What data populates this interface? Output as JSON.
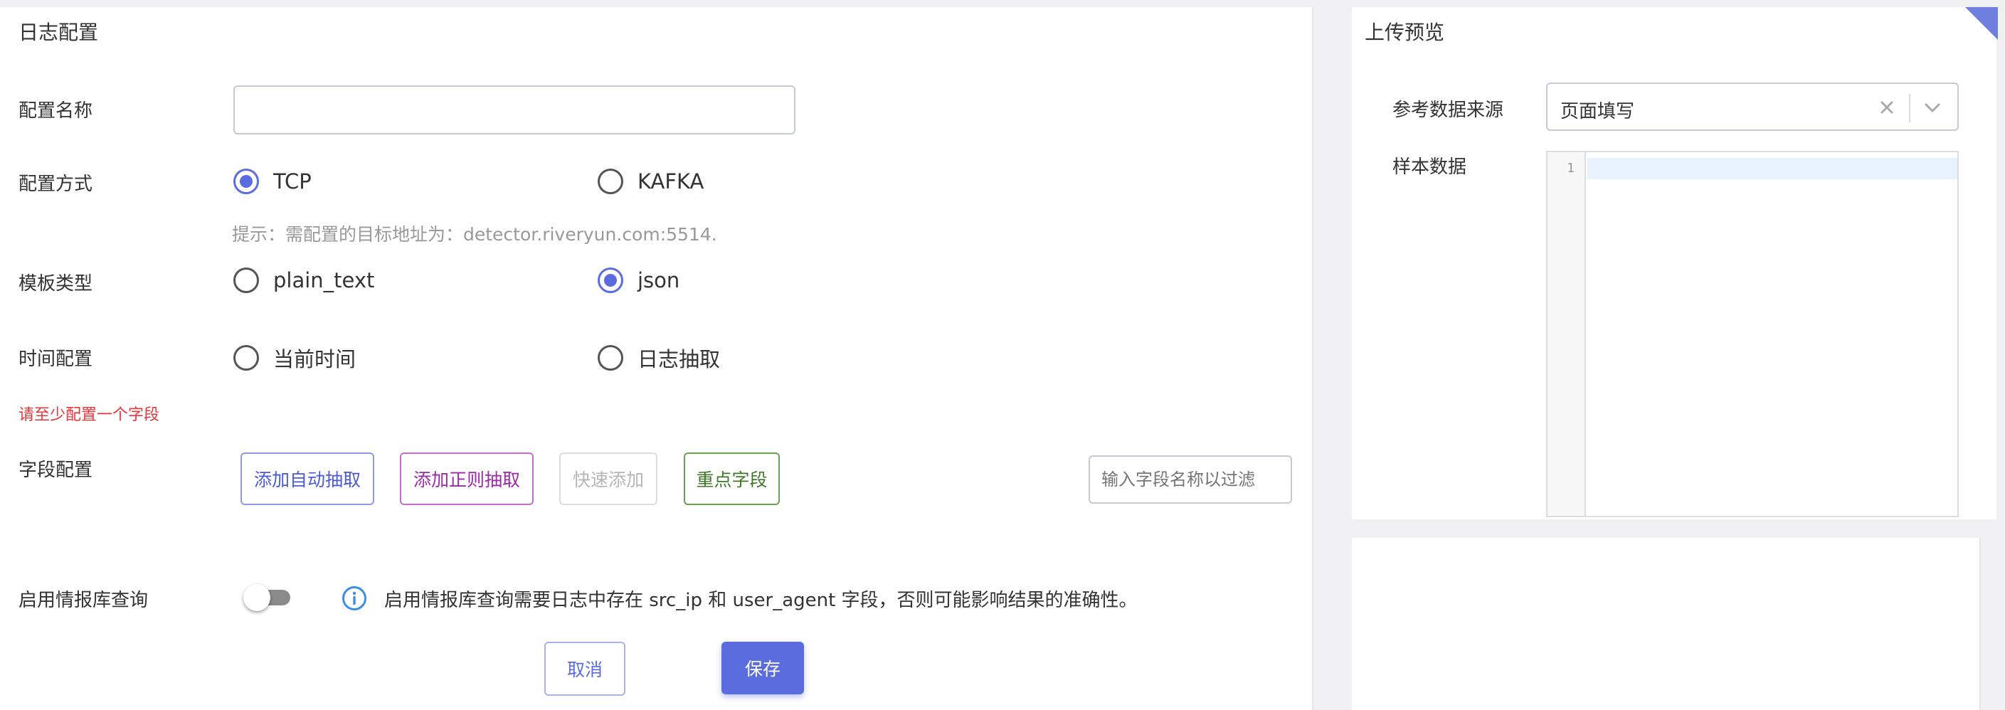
{
  "log_config": {
    "title": "日志配置",
    "name_label": "配置名称",
    "name_value": "",
    "method_label": "配置方式",
    "method_options": [
      "TCP",
      "KAFKA"
    ],
    "method_selected": "TCP",
    "hint": "提示：需配置的目标地址为：detector.riveryun.com:5514.",
    "template_label": "模板类型",
    "template_options": [
      "plain_text",
      "json"
    ],
    "template_selected": "json",
    "time_label": "时间配置",
    "time_options": [
      "当前时间",
      "日志抽取"
    ],
    "time_selected": "",
    "error": "请至少配置一个字段",
    "field_label": "字段配置",
    "field_buttons": {
      "auto": "添加自动抽取",
      "regex": "添加正则抽取",
      "quick": "快速添加",
      "key": "重点字段"
    },
    "field_filter_placeholder": "输入字段名称以过滤",
    "intel_label": "启用情报库查询",
    "intel_enabled": false,
    "intel_info": "启用情报库查询需要日志中存在 src_ip 和 user_agent 字段，否则可能影响结果的准确性。",
    "cancel_label": "取消",
    "save_label": "保存"
  },
  "upload_preview": {
    "title": "上传预览",
    "source_label": "参考数据来源",
    "source_value": "页面填写",
    "sample_label": "样本数据",
    "editor_line_number": "1",
    "sample_value": ""
  },
  "colors": {
    "accent": "#5b6dde",
    "error": "#e5373a",
    "regex_purple": "#9a2aa8",
    "key_green": "#3c7a2a"
  },
  "icons": [
    "info-icon",
    "clear-icon",
    "chevron-down-icon",
    "corner-flag-icon"
  ]
}
